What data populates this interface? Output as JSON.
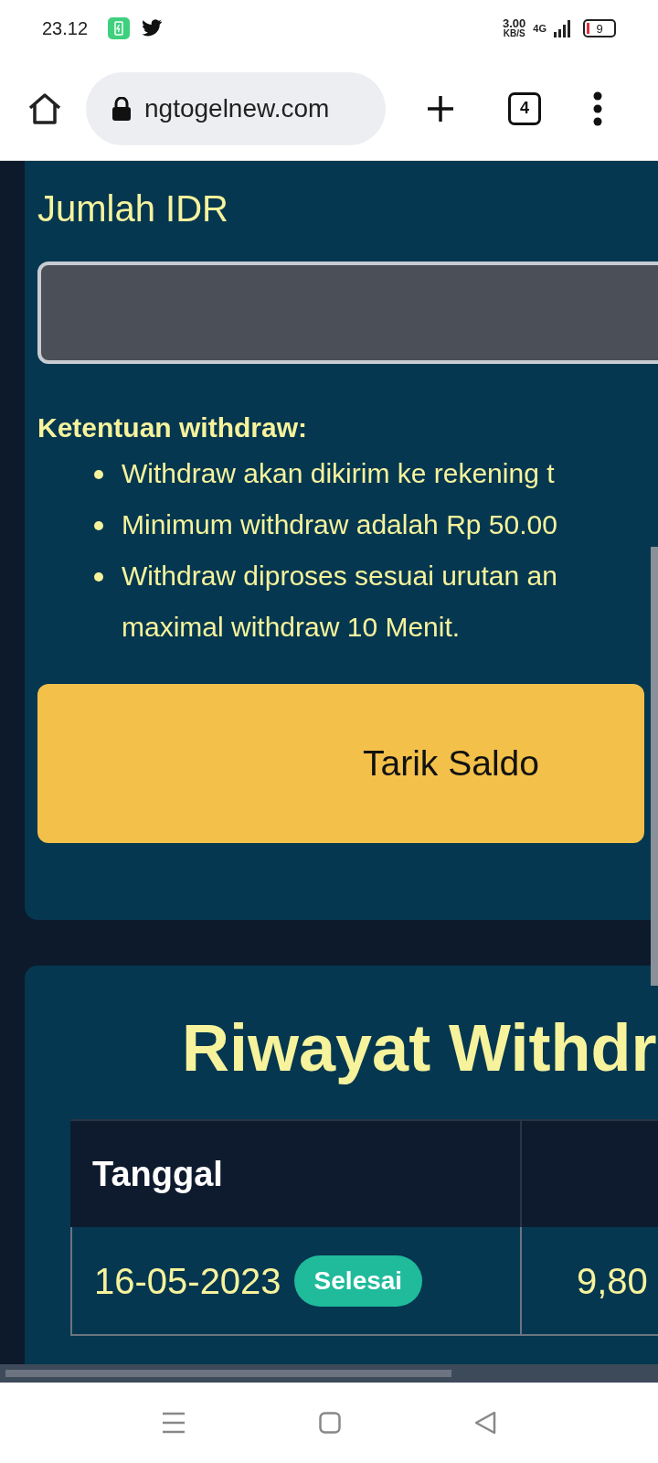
{
  "status_bar": {
    "time": "23.12",
    "speed": "3.00",
    "speed_unit": "KB/S",
    "network": "4G",
    "battery": "9"
  },
  "browser": {
    "url": "ngtogelnew.com",
    "tab_count": "4"
  },
  "withdraw_form": {
    "amount_label": "Jumlah IDR",
    "rules_title": "Ketentuan withdraw:",
    "rules": [
      {
        "lines": [
          "Withdraw akan dikirim ke rekening t"
        ]
      },
      {
        "lines": [
          "Minimum withdraw adalah Rp 50.00"
        ]
      },
      {
        "lines": [
          "Withdraw diproses sesuai urutan an",
          "maximal withdraw 10 Menit."
        ]
      }
    ],
    "submit_button": "Tarik Saldo"
  },
  "history": {
    "title": "Riwayat Withdr",
    "columns": [
      "Tanggal"
    ],
    "rows": [
      {
        "date": "16-05-2023",
        "status": "Selesai",
        "color": "#1fbb9b",
        "column_2": "9,80"
      }
    ]
  }
}
